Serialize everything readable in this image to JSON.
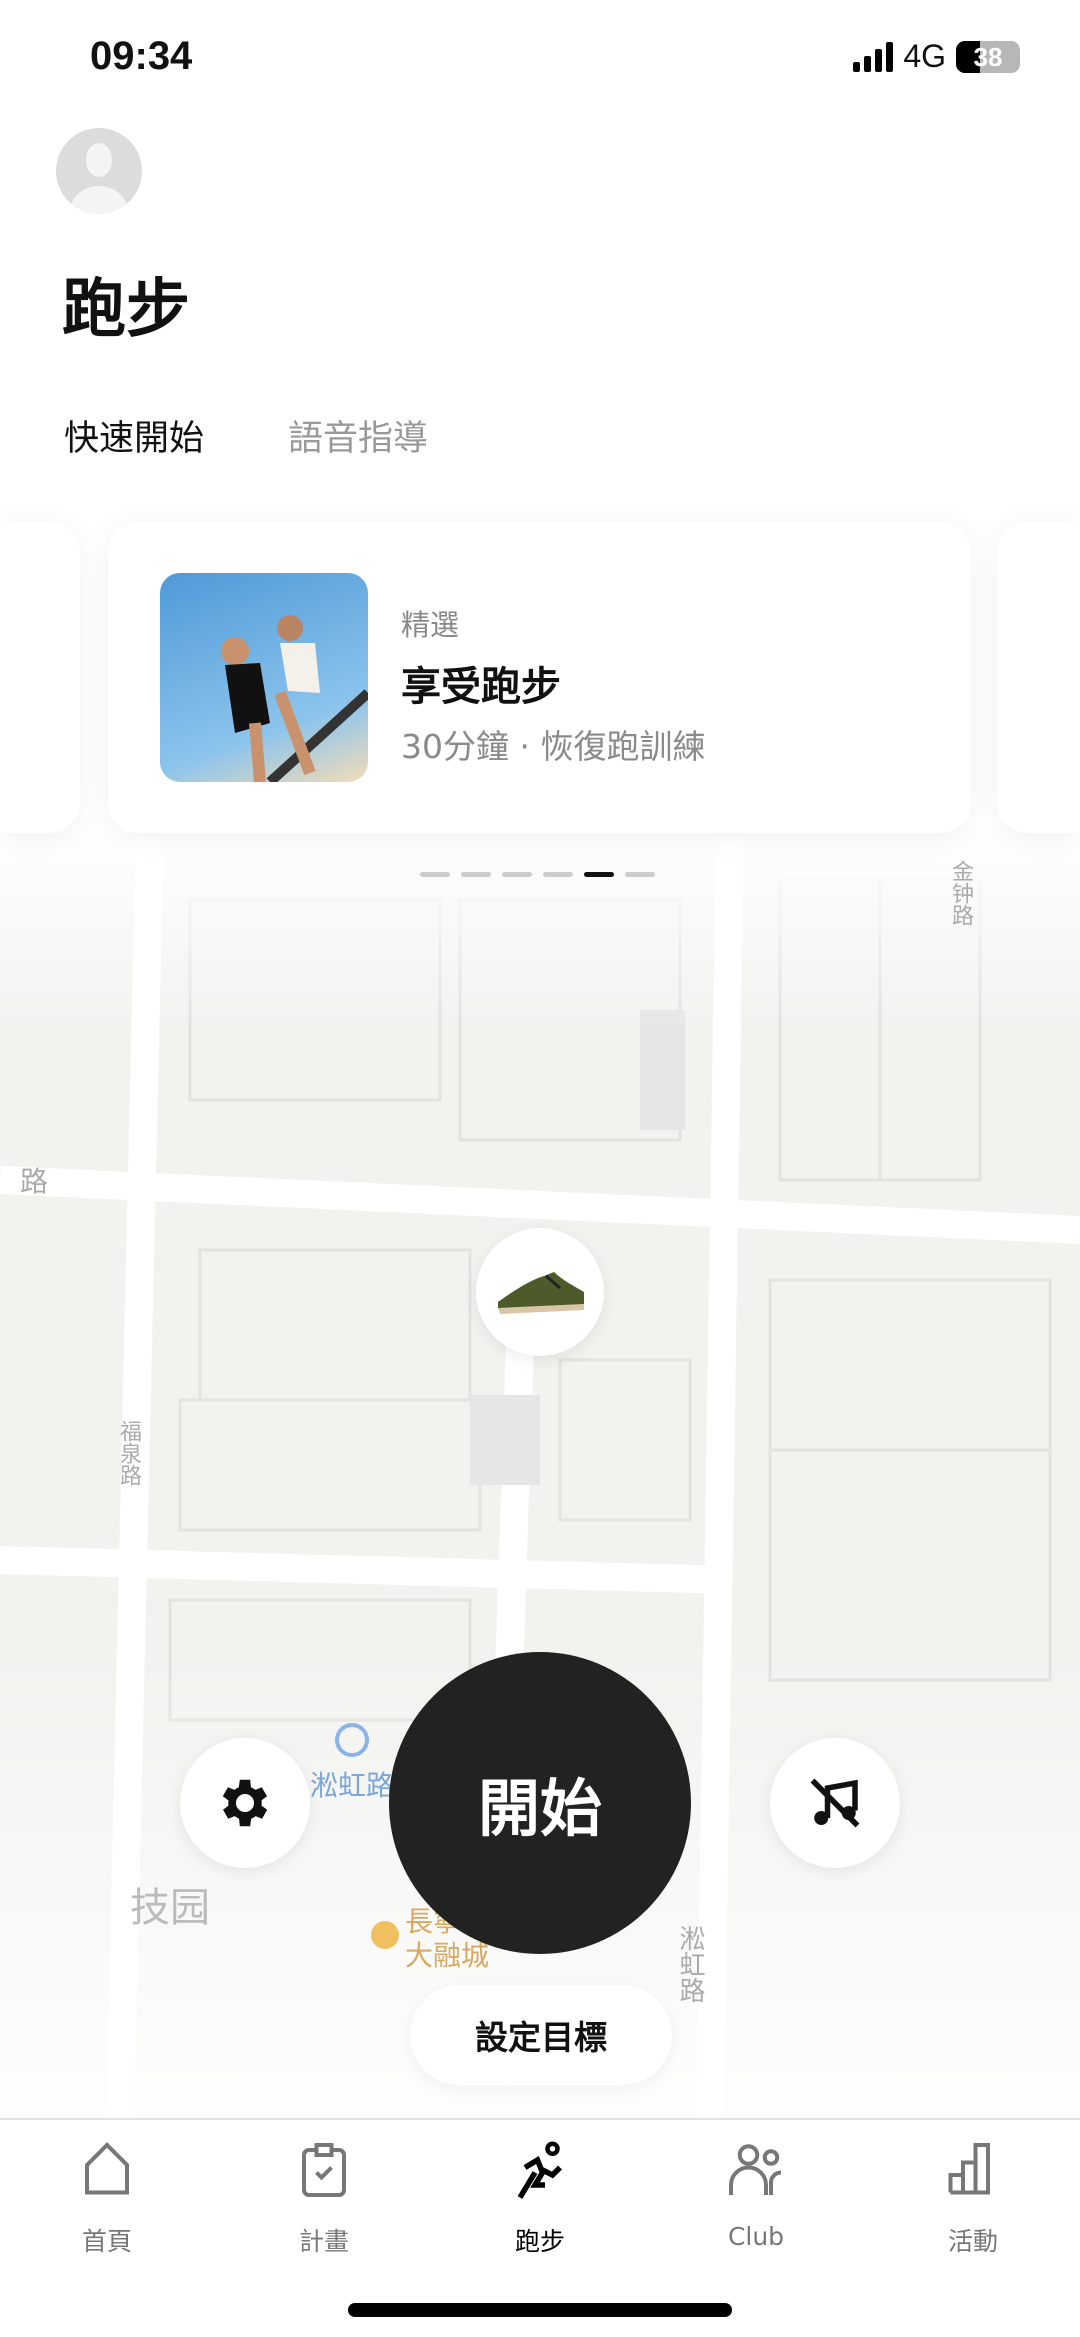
{
  "status_bar": {
    "time": "09:34",
    "network": "4G",
    "battery": "38",
    "battery_level": 38
  },
  "header": {
    "title": "跑步"
  },
  "tabs": [
    {
      "label": "快速開始",
      "active": true
    },
    {
      "label": "語音指導",
      "active": false
    }
  ],
  "featured_card": {
    "tag": "精選",
    "title": "享受跑步",
    "subtitle": "30分鐘 · 恢復跑訓練",
    "image": "two runners under blue sky"
  },
  "carousel": {
    "count": 6,
    "active_index": 4
  },
  "map": {
    "labels": [
      "淞虹路",
      "長寧",
      "大融城",
      "技园",
      "淞虹路",
      "福泉路",
      "金钟路",
      "路"
    ]
  },
  "controls": {
    "start_label": "開始",
    "goal_label": "設定目標",
    "settings_icon": "gear-icon",
    "music_icon": "music-off-icon",
    "shoe_marker": "shoe-icon"
  },
  "bottom_nav": [
    {
      "label": "首頁",
      "icon": "home-icon"
    },
    {
      "label": "計畫",
      "icon": "clipboard-check-icon"
    },
    {
      "label": "跑步",
      "icon": "runner-icon",
      "active": true
    },
    {
      "label": "Club",
      "icon": "people-icon"
    },
    {
      "label": "活動",
      "icon": "bar-chart-icon"
    }
  ],
  "colors": {
    "active": "#000000",
    "inactive": "#777777",
    "start_button": "#222222"
  }
}
